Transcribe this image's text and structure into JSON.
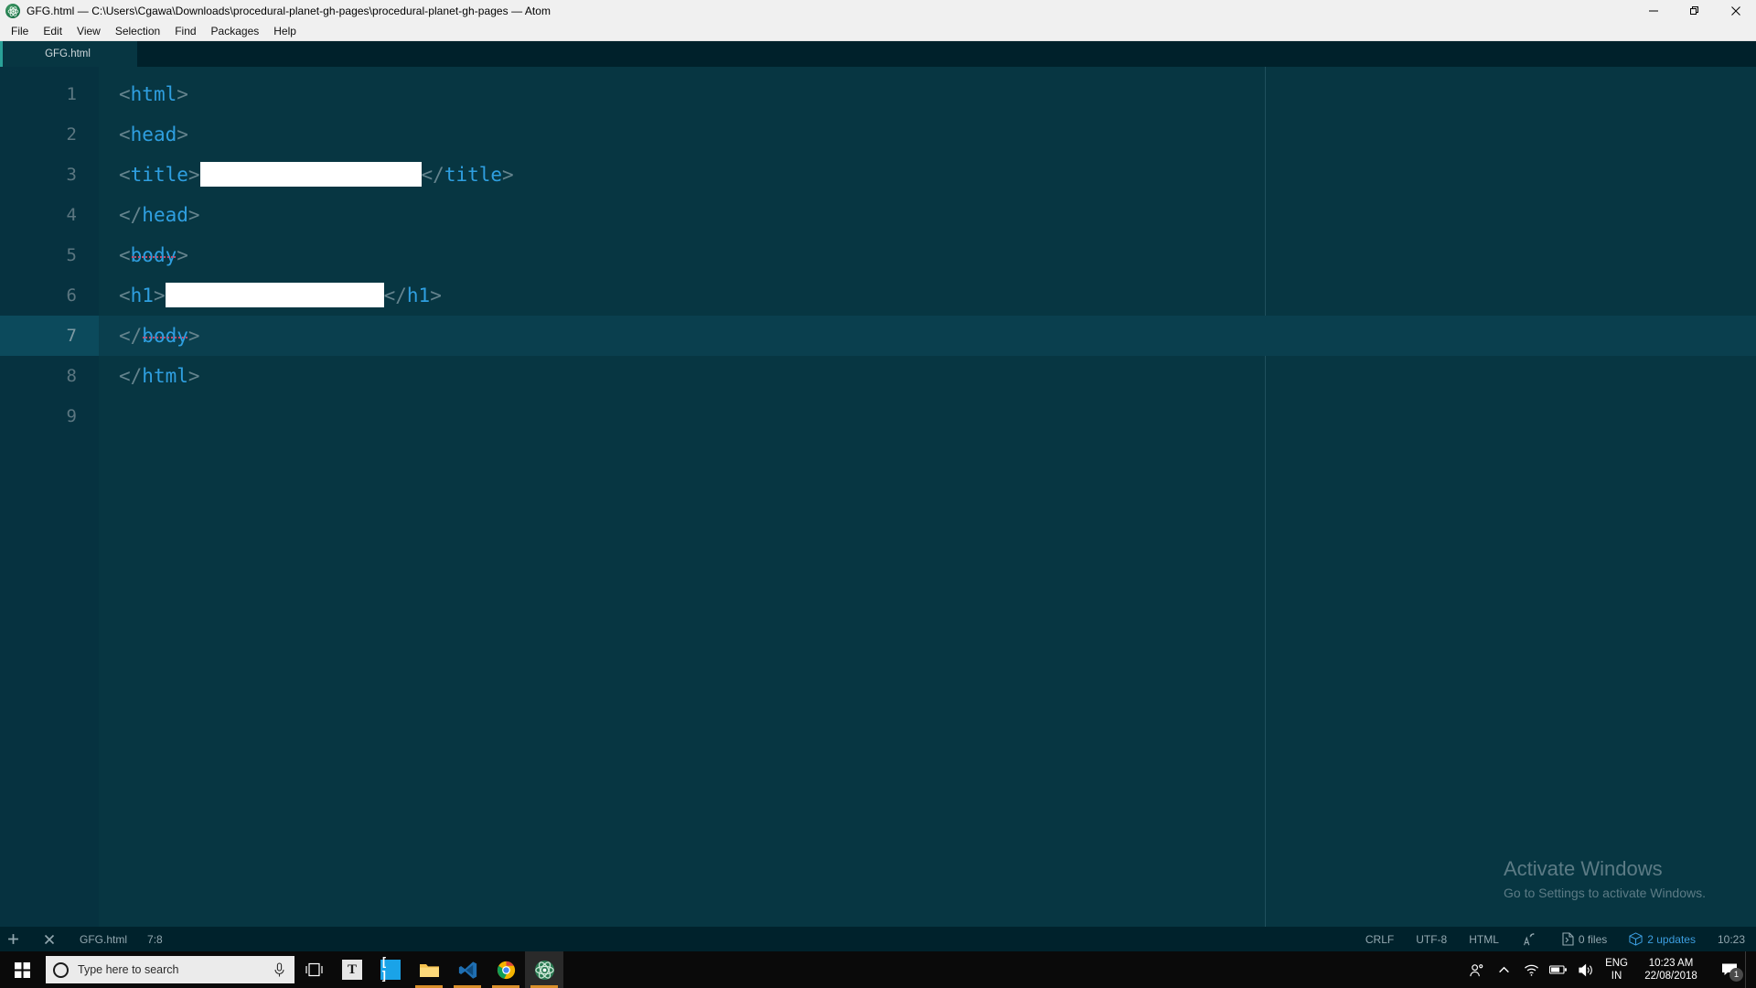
{
  "window": {
    "title": "GFG.html — C:\\Users\\Cgawa\\Downloads\\procedural-planet-gh-pages\\procedural-planet-gh-pages — Atom",
    "app_icon": "atom-icon",
    "controls": {
      "minimize": "minimize-icon",
      "restore": "restore-icon",
      "close": "close-icon"
    }
  },
  "menubar": {
    "items": [
      {
        "label": "File"
      },
      {
        "label": "Edit"
      },
      {
        "label": "View"
      },
      {
        "label": "Selection"
      },
      {
        "label": "Find"
      },
      {
        "label": "Packages"
      },
      {
        "label": "Help"
      }
    ]
  },
  "tabs": [
    {
      "label": "GFG.html",
      "active": true
    }
  ],
  "editor": {
    "active_line": 7,
    "line_numbers": [
      "1",
      "2",
      "3",
      "4",
      "5",
      "6",
      "7",
      "8",
      "9"
    ],
    "code": [
      {
        "n": "1",
        "tokens": [
          {
            "t": "punc",
            "v": "<"
          },
          {
            "t": "tag",
            "v": "html"
          },
          {
            "t": "punc",
            "v": ">"
          }
        ]
      },
      {
        "n": "2",
        "tokens": [
          {
            "t": "punc",
            "v": "<"
          },
          {
            "t": "tag",
            "v": "head"
          },
          {
            "t": "punc",
            "v": ">"
          }
        ]
      },
      {
        "n": "3",
        "tokens": [
          {
            "t": "punc",
            "v": "<"
          },
          {
            "t": "tag",
            "v": "title"
          },
          {
            "t": "punc",
            "v": ">"
          },
          {
            "t": "redact",
            "v": "t3"
          },
          {
            "t": "punc",
            "v": "</"
          },
          {
            "t": "tag",
            "v": "title"
          },
          {
            "t": "punc",
            "v": ">"
          }
        ]
      },
      {
        "n": "4",
        "tokens": [
          {
            "t": "punc",
            "v": "</"
          },
          {
            "t": "tag",
            "v": "head"
          },
          {
            "t": "punc",
            "v": ">"
          }
        ]
      },
      {
        "n": "5",
        "tokens": [
          {
            "t": "punc",
            "v": "<"
          },
          {
            "t": "tagu",
            "v": "body"
          },
          {
            "t": "punc",
            "v": ">"
          }
        ]
      },
      {
        "n": "6",
        "tokens": [
          {
            "t": "punc",
            "v": "<"
          },
          {
            "t": "tag",
            "v": "h1"
          },
          {
            "t": "punc",
            "v": ">"
          },
          {
            "t": "redact",
            "v": "t6"
          },
          {
            "t": "punc",
            "v": "</"
          },
          {
            "t": "tag",
            "v": "h1"
          },
          {
            "t": "punc",
            "v": ">"
          }
        ]
      },
      {
        "n": "7",
        "tokens": [
          {
            "t": "punc",
            "v": "</"
          },
          {
            "t": "tagu",
            "v": "body"
          },
          {
            "t": "punc",
            "v": ">"
          }
        ]
      },
      {
        "n": "8",
        "tokens": [
          {
            "t": "punc",
            "v": "</"
          },
          {
            "t": "tag",
            "v": "html"
          },
          {
            "t": "punc",
            "v": ">"
          }
        ]
      },
      {
        "n": "9",
        "tokens": []
      }
    ]
  },
  "watermark": {
    "line1": "Activate Windows",
    "line2": "Go to Settings to activate Windows."
  },
  "statusbar": {
    "add_icon": "plus-icon",
    "close_icon": "close-icon",
    "file_name": "GFG.html",
    "cursor_position": "7:8",
    "line_ending": "CRLF",
    "encoding": "UTF-8",
    "grammar": "HTML",
    "spellcheck_icon": "spell-check-icon",
    "files_icon": "file-icon",
    "files_count": "0 files",
    "updates_icon": "package-icon",
    "updates": "2 updates",
    "time": "10:23"
  },
  "taskbar": {
    "start_icon": "windows-start-icon",
    "cortana_icon": "cortana-circle-icon",
    "search_placeholder": "Type here to search",
    "mic_icon": "microphone-icon",
    "taskview_icon": "task-view-icon",
    "apps": [
      {
        "name": "teams-icon",
        "glyph": "T",
        "running": false
      },
      {
        "name": "brackets-icon",
        "glyph": "[ ]",
        "running": false
      },
      {
        "name": "file-explorer-icon",
        "glyph": "",
        "running": true
      },
      {
        "name": "vscode-icon",
        "glyph": "",
        "running": true
      },
      {
        "name": "chrome-icon",
        "glyph": "",
        "running": true
      },
      {
        "name": "atom-icon",
        "glyph": "",
        "running": true
      }
    ],
    "tray": {
      "people_icon": "people-icon",
      "chevron_icon": "chevron-up-icon",
      "network_icon": "wifi-icon",
      "battery_icon": "battery-icon",
      "volume_icon": "volume-icon",
      "lang_top": "ENG",
      "lang_bottom": "IN",
      "time": "10:23 AM",
      "date": "22/08/2018",
      "notification_icon": "notification-icon",
      "notification_count": "1"
    }
  },
  "colors": {
    "editor_bg": "#073642",
    "gutter_bg": "#063240",
    "tag": "#2f9fe0",
    "punctuation": "#64838d",
    "accent": "#2aa198",
    "link": "#3c9ee0",
    "spell_underline": "#c04a6b"
  }
}
